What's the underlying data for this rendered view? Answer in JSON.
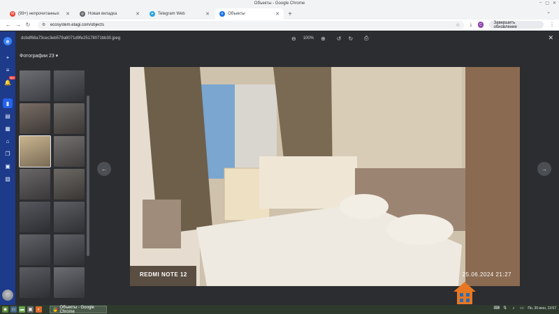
{
  "window": {
    "title": "Объекты - Google Chrome"
  },
  "tabs": [
    {
      "label": "(99+) непрочитанных"
    },
    {
      "label": "Новая вкладка"
    },
    {
      "label": "Telegram Web"
    },
    {
      "label": "Объекты"
    }
  ],
  "toolbar": {
    "url": "ecosystem.etagi.com/objects",
    "update_label": "Завершить обновление"
  },
  "rail": {
    "badge": "99+"
  },
  "viewer": {
    "filename": "dcbdf68a73cec3eb579a8071d9fe25178071bb30.jpeg",
    "zoom": "100%",
    "thumbs_title": "Фотографии 23",
    "photo_label_left": "REDMI NOTE 12",
    "photo_label_right": "25.06.2024  21:27",
    "colors": {
      "rail": "#1e3a8a",
      "panel": "#2b2d30",
      "accent": "#2563eb"
    }
  },
  "taskbar": {
    "task_label": "Объекты - Google Chrome",
    "clock": "Пн, 30 июн, 13:57"
  }
}
